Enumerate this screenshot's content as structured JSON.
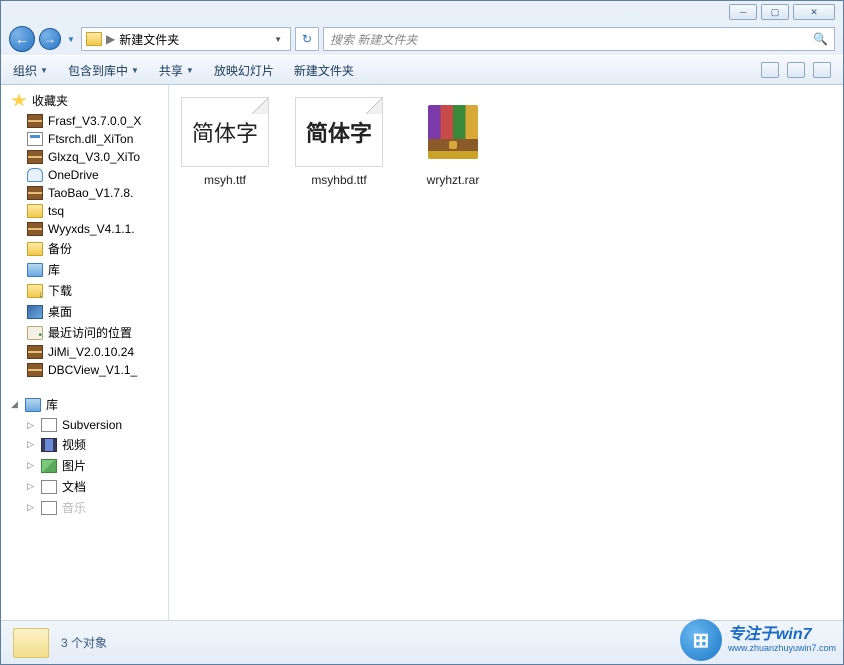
{
  "window": {
    "title": ""
  },
  "address": {
    "sep": "▶",
    "folder": "新建文件夹"
  },
  "search": {
    "placeholder": "搜索 新建文件夹"
  },
  "toolbar": {
    "organize": "组织",
    "include": "包含到库中",
    "share": "共享",
    "slideshow": "放映幻灯片",
    "newfolder": "新建文件夹"
  },
  "sidebar": {
    "favorites_label": "收藏夹",
    "favorites": [
      "Frasf_V3.7.0.0_X",
      "Ftsrch.dll_XiTon",
      "Glxzq_V3.0_XiTo",
      "OneDrive",
      "TaoBao_V1.7.8.",
      "tsq",
      "Wyyxds_V4.1.1.",
      "备份",
      "库",
      "下载",
      "桌面",
      "最近访问的位置",
      "JiMi_V2.0.10.24",
      "DBCView_V1.1_"
    ],
    "favorites_icons": [
      "rar",
      "sys",
      "rar",
      "cloud",
      "rar",
      "folder",
      "rar",
      "folder",
      "lib",
      "download",
      "desk",
      "recent",
      "rar",
      "rar"
    ],
    "libraries_label": "库",
    "libraries": [
      "Subversion",
      "视频",
      "图片",
      "文档",
      "音乐"
    ],
    "libraries_icons": [
      "svn",
      "video",
      "pic",
      "doc",
      "doc"
    ]
  },
  "files": [
    {
      "name": "msyh.ttf",
      "type": "font",
      "preview": "简体字",
      "bold": false
    },
    {
      "name": "msyhbd.ttf",
      "type": "font",
      "preview": "简体字",
      "bold": true
    },
    {
      "name": "wryhzt.rar",
      "type": "rar"
    }
  ],
  "statusbar": {
    "text": "3 个对象"
  },
  "watermark": {
    "line1": "专注于win7",
    "line2": "www.zhuanzhuyuwin7.com"
  }
}
